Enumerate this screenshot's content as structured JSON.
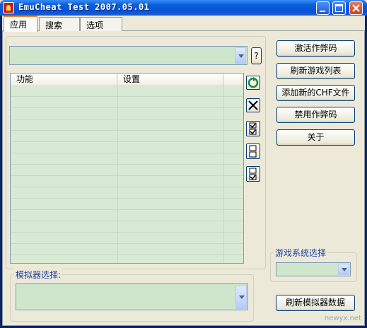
{
  "window": {
    "title": "EmuCheat Test 2007.05.01"
  },
  "tabs": [
    {
      "label": "应用",
      "active": true
    },
    {
      "label": "搜索",
      "active": false
    },
    {
      "label": "选项",
      "active": false
    }
  ],
  "main": {
    "cheat_combo_value": "",
    "help_button_label": "?",
    "list_columns": [
      "功能",
      "设置"
    ],
    "list_rows": [
      "",
      "",
      "",
      "",
      "",
      "",
      "",
      "",
      "",
      "",
      "",
      "",
      "",
      "",
      ""
    ]
  },
  "icon_buttons": [
    {
      "icon": "refresh-icon"
    },
    {
      "icon": "delete-icon"
    },
    {
      "icon": "check-all-icon"
    },
    {
      "icon": "uncheck-all-icon"
    },
    {
      "icon": "toggle-check-icon"
    }
  ],
  "actions": {
    "activate": "激活作弊码",
    "refresh_list": "刷新游戏列表",
    "add_chf": "添加新的CHF文件",
    "disable": "禁用作弊码",
    "about": "关于"
  },
  "game_system": {
    "label": "游戏系统选择",
    "value": ""
  },
  "emulator": {
    "label": "模拟器选择:",
    "value": ""
  },
  "refresh_emulator_label": "刷新模拟器数据",
  "watermark": "newyx.net",
  "colors": {
    "titlebar": "#0a5fe0",
    "list_bg": "#d8ead4",
    "group_label": "#1f3f9f"
  }
}
